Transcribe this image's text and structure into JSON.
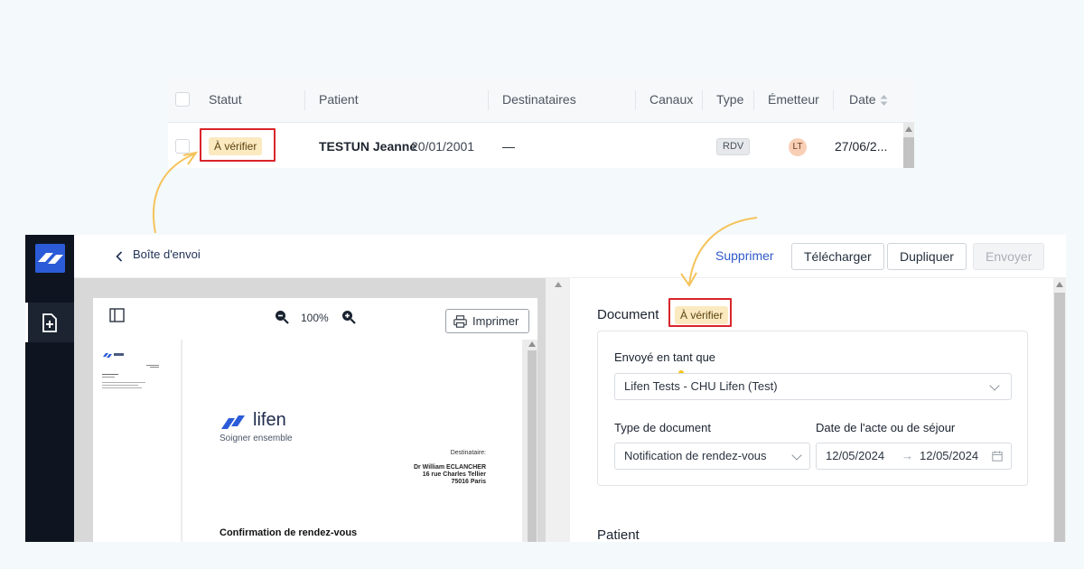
{
  "table": {
    "headers": {
      "statut": "Statut",
      "patient": "Patient",
      "destinataires": "Destinataires",
      "canaux": "Canaux",
      "type": "Type",
      "emetteur": "Émetteur",
      "date": "Date"
    },
    "row": {
      "status": "À vérifier",
      "patient_name": "TESTUN Jeanne",
      "patient_dob": "20/01/2001",
      "destinataires": "—",
      "type": "RDV",
      "emetteur_initials": "LT",
      "date": "27/06/2..."
    }
  },
  "topbar": {
    "back_label": "Boîte d'envoi",
    "delete_label": "Supprimer",
    "download_label": "Télécharger",
    "duplicate_label": "Dupliquer",
    "send_label": "Envoyer"
  },
  "viewer": {
    "zoom": "100%",
    "print_label": "Imprimer",
    "doc": {
      "brand": "lifen",
      "tagline": "Soigner ensemble",
      "recipient_label": "Destinataire:",
      "recipient_name": "Dr William ECLANCHER",
      "recipient_street": "16 rue Charles Tellier",
      "recipient_city": "75016 Paris",
      "heading": "Confirmation de rendez-vous"
    }
  },
  "details": {
    "document_title": "Document",
    "status": "À vérifier",
    "sent_as_label": "Envoyé en tant que",
    "sent_as_value": "Lifen Tests - CHU Lifen (Test)",
    "doc_type_label": "Type de document",
    "doc_type_value": "Notification de rendez-vous",
    "date_label": "Date de l'acte ou de séjour",
    "date_start": "12/05/2024",
    "date_end": "12/05/2024",
    "date_arrow": "→",
    "patient_title": "Patient"
  },
  "colors": {
    "accent": "#2e59c9",
    "badge_bg": "#fbe9c0",
    "highlight": "#d9252a",
    "arrow": "#f5c35a",
    "rail": "#0e1520"
  }
}
